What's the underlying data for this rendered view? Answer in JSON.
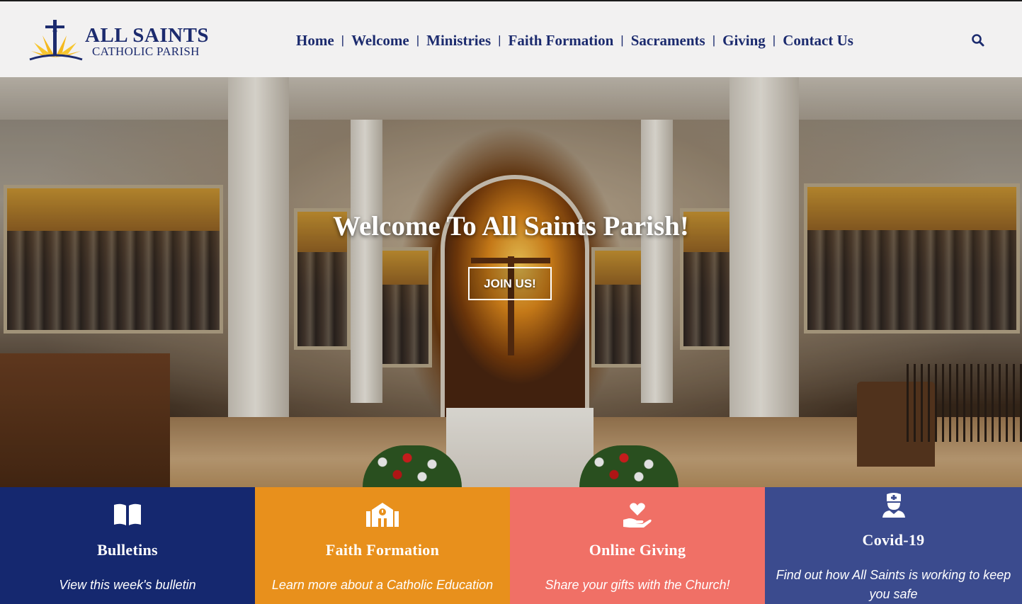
{
  "logo": {
    "title": "ALL SAINTS",
    "subtitle": "CATHOLIC PARISH"
  },
  "nav": {
    "items": [
      "Home",
      "Welcome",
      "Ministries",
      "Faith Formation",
      "Sacraments",
      "Giving",
      "Contact Us"
    ],
    "separator": "|",
    "search_icon": "search-icon"
  },
  "hero": {
    "title": "Welcome To All Saints Parish!",
    "button_label": "JOIN US!"
  },
  "tiles": [
    {
      "icon": "book-icon",
      "title": "Bulletins",
      "description": "View this week's bulletin",
      "color": "#15286f"
    },
    {
      "icon": "school-icon",
      "title": "Faith Formation",
      "description": "Learn more about a Catholic Education",
      "color": "#e8901c"
    },
    {
      "icon": "hand-heart-icon",
      "title": "Online Giving",
      "description": "Share your gifts with the Church!",
      "color": "#f07066"
    },
    {
      "icon": "nurse-icon",
      "title": "Covid-19",
      "description": "Find out how All Saints is working to keep you safe",
      "color": "#3b4b8e"
    }
  ],
  "colors": {
    "brand_navy": "#1c2b6e",
    "header_bg": "#f2f1f1"
  }
}
